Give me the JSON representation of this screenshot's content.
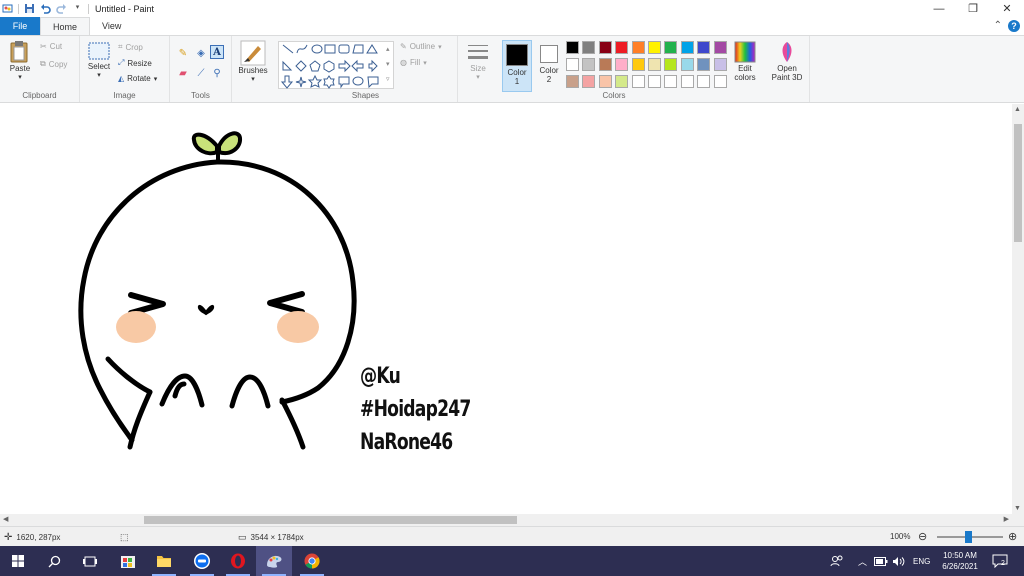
{
  "window": {
    "title": "Untitled - Paint",
    "minimize": "—",
    "restore": "❐",
    "close": "✕"
  },
  "tabs": {
    "file": "File",
    "home": "Home",
    "view": "View"
  },
  "ribbon": {
    "clipboard": {
      "group": "Clipboard",
      "paste": "Paste",
      "cut": "Cut",
      "copy": "Copy"
    },
    "image": {
      "group": "Image",
      "select": "Select",
      "crop": "Crop",
      "resize": "Resize",
      "rotate": "Rotate"
    },
    "tools": {
      "group": "Tools"
    },
    "brushes": {
      "label": "Brushes"
    },
    "shapes": {
      "group": "Shapes",
      "outline": "Outline",
      "fill": "Fill"
    },
    "size": {
      "label": "Size"
    },
    "colors": {
      "group": "Colors",
      "color1": "Color\n1",
      "color1_a": "Color",
      "color1_b": "1",
      "color2_a": "Color",
      "color2_b": "2",
      "edit_a": "Edit",
      "edit_b": "colors",
      "color1_value": "#000000",
      "color2_value": "#ffffff",
      "palette": [
        "#000000",
        "#7f7f7f",
        "#880015",
        "#ed1c24",
        "#ff7f27",
        "#fff200",
        "#22b14c",
        "#00a2e8",
        "#3f48cc",
        "#a349a4",
        "#ffffff",
        "#c3c3c3",
        "#b97a57",
        "#ffaec9",
        "#ffc90e",
        "#efe4b0",
        "#b5e61d",
        "#99d9ea",
        "#7092be",
        "#c8bfe7",
        "#c8a08a",
        "#f4a3a3",
        "#f9c4a8",
        "#d4e98a",
        "#ffffff",
        "#ffffff",
        "#ffffff",
        "#ffffff",
        "#ffffff",
        "#ffffff"
      ]
    },
    "paint3d": {
      "a": "Open",
      "b": "Paint 3D"
    }
  },
  "canvas": {
    "text_lines": [
      "@Ku",
      "#Hoidap247",
      "NaRone46"
    ],
    "sprout_color": "#c9e27a",
    "blush_color": "#f8c9a5"
  },
  "status": {
    "cursor_pos": "1620, 287px",
    "image_size": "3544 × 1784px",
    "zoom": "100%"
  },
  "taskbar": {
    "language": "ENG",
    "time": "10:50 AM",
    "date": "6/26/2021",
    "notifications": "2"
  }
}
